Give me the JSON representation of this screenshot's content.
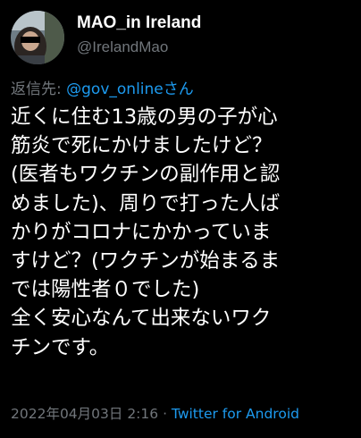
{
  "author": {
    "display_name": "MAO_in Ireland",
    "handle": "@IrelandMao"
  },
  "reply": {
    "prefix": "返信先: ",
    "mention": "@gov_onlineさん"
  },
  "tweet": {
    "text": "近くに住む13歳の男の子が心\n筋炎で死にかけましたけど？\n(医者もワクチンの副作用と認\nめました)、周りで打った人ば\nかりがコロナにかかっていま\nすけど？(ワクチンが始まるま\nでは陽性者０でした)\n全く安心なんて出来ないワク\nチンです。"
  },
  "meta": {
    "timestamp": "2022年04月03日 2:16",
    "separator": " · ",
    "source": "Twitter for Android"
  },
  "colors": {
    "background": "#000000",
    "text": "#ffffff",
    "secondary": "#71767b",
    "link": "#1d9bf0"
  }
}
